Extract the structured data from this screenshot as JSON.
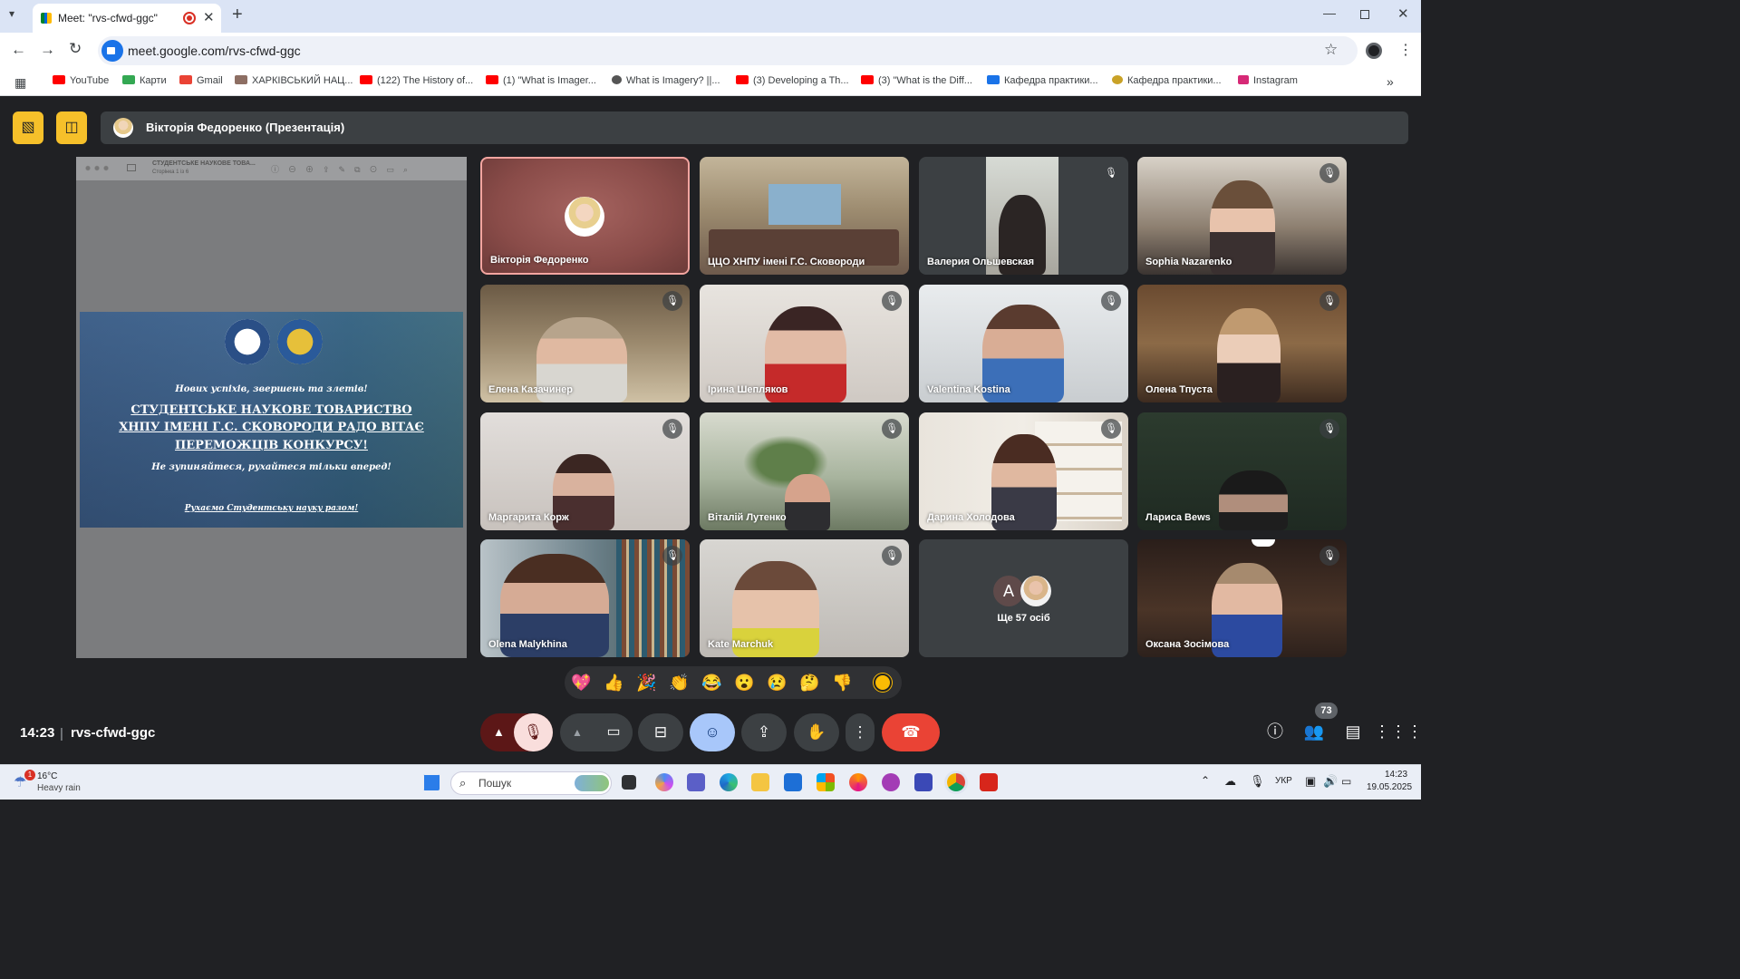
{
  "browser": {
    "tab_title": "Meet: \"rvs-cfwd-ggc\"",
    "url": "meet.google.com/rvs-cfwd-ggc",
    "bookmarks": [
      {
        "label": "YouTube",
        "color": "#ff0000"
      },
      {
        "label": "Карти",
        "color": "#34a853"
      },
      {
        "label": "Gmail",
        "color": "#ea4335"
      },
      {
        "label": "ХАРКІВСЬКИЙ НАЦ...",
        "color": "#8d6e63"
      },
      {
        "label": "(122) The History of...",
        "color": "#ff0000"
      },
      {
        "label": "(1) \"What is Imager...",
        "color": "#ff0000"
      },
      {
        "label": "What is Imagery? ||...",
        "color": "#555555"
      },
      {
        "label": "(3) Developing a Th...",
        "color": "#ff0000"
      },
      {
        "label": "(3) \"What is the Diff...",
        "color": "#ff0000"
      },
      {
        "label": "Кафедра практики...",
        "color": "#1a73e8"
      },
      {
        "label": "Кафедра практики...",
        "color": "#c9a227"
      },
      {
        "label": "Instagram",
        "color": "#d62976"
      }
    ]
  },
  "meet": {
    "presenter_bar": "Вікторія Федоренко (Презентація)",
    "slide": {
      "toolbar_title": "СТУДЕНТСЬКЕ НАУКОВЕ ТОВА...",
      "toolbar_page": "Сторінка 1 із 6",
      "line1": "Нових успіхів, звершень та злетів!",
      "headline1": "СТУДЕНТСЬКЕ НАУКОВЕ ТОВАРИСТВО",
      "headline2": "ХНПУ ІМЕНІ Г.С. СКОВОРОДИ РАДО ВІТАЄ",
      "headline3": "ПЕРЕМОЖЦІВ КОНКУРСУ!",
      "line2": "Не зупиняйтеся, рухайтеся тільки вперед!",
      "line3": "Рухаємо Студентську науку разом!"
    },
    "participants": [
      {
        "name": "Вікторія Федоренко"
      },
      {
        "name": "ЦЦО ХНПУ імені Г.С. Сковороди"
      },
      {
        "name": "Валерия Ольшевская"
      },
      {
        "name": "Sophia Nazarenko"
      },
      {
        "name": "Елена Казачинер"
      },
      {
        "name": "Ірина Шепляков"
      },
      {
        "name": "Valentina Kostina"
      },
      {
        "name": "Олена Тпуста"
      },
      {
        "name": "Маргарита Корж"
      },
      {
        "name": "Віталій Лутенко"
      },
      {
        "name": "Дарина Холодова"
      },
      {
        "name": "Лариса Bews"
      },
      {
        "name": "Olena Malykhina"
      },
      {
        "name": "Kate Marchuk"
      },
      {
        "name": "Оксана Зосімова"
      }
    ],
    "more_tile": {
      "avatar_letter": "A",
      "label": "Ще 57 осіб"
    },
    "reactions": [
      "💖",
      "👍",
      "🎉",
      "👏",
      "😂",
      "😮",
      "😢",
      "🤔",
      "👎"
    ],
    "clock": "14:23",
    "separator": "|",
    "meeting_code": "rvs-cfwd-ggc",
    "participants_count": "73",
    "colors": {
      "accent_yellow": "#f6c02a",
      "end_call": "#ea4335",
      "active_blue": "#8ab4f8",
      "mic_off_bg": "#f9dedc"
    }
  },
  "taskbar": {
    "weather_temp": "16°C",
    "weather_desc": "Heavy rain",
    "weather_badge": "1",
    "search_placeholder": "Пошук",
    "lang": "УКР",
    "time": "14:23",
    "date": "19.05.2025"
  }
}
